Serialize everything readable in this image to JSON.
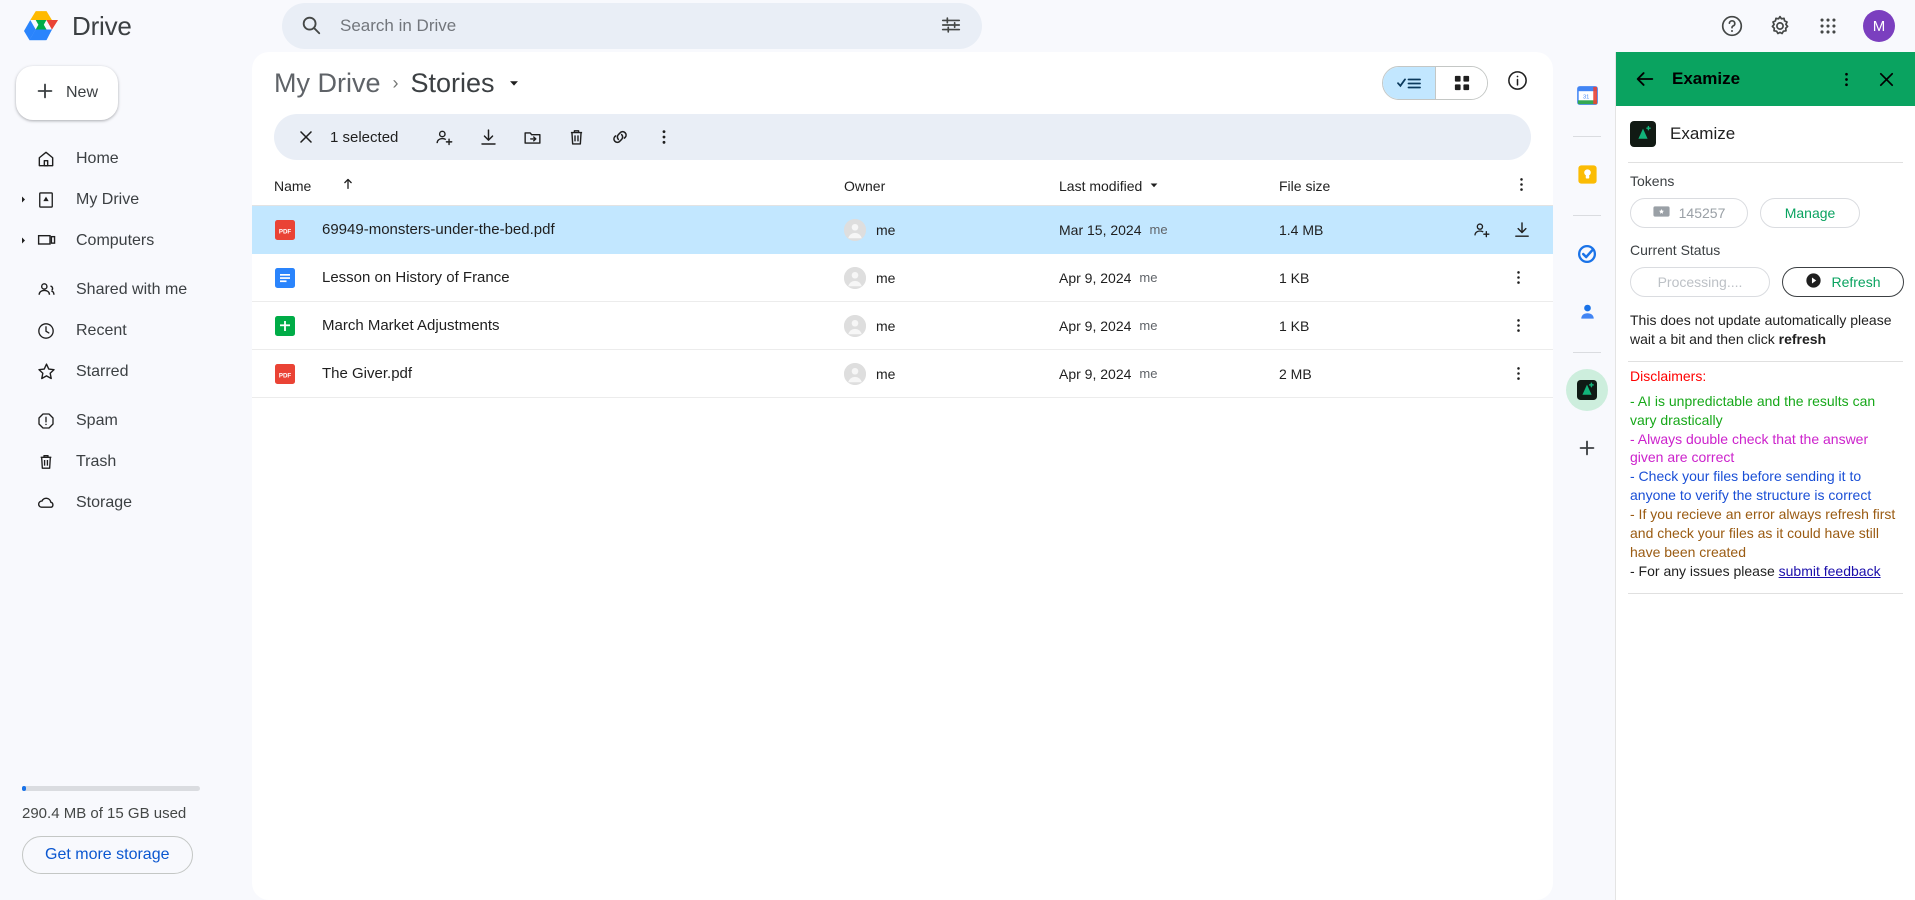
{
  "app": {
    "brand": "Drive",
    "brand_logo_colors": {
      "blue": "#2a84fc",
      "green": "#00ac47",
      "yellow": "#ffba00",
      "red": "#ea4335"
    }
  },
  "search": {
    "placeholder": "Search in Drive",
    "value": "",
    "icon": "search-icon",
    "filter_icon": "tune-icon"
  },
  "topbar": {
    "help_icon": "help-circle-icon",
    "settings_icon": "gear-icon",
    "apps_icon": "apps-grid-icon",
    "avatar_initial": "M",
    "avatar_color": "#7b3fbf"
  },
  "sidebar": {
    "new_label": "New",
    "new_icon": "plus-icon",
    "groups": [
      {
        "items": [
          {
            "label": "Home",
            "icon": "home-icon",
            "expandable": false
          },
          {
            "label": "My Drive",
            "icon": "drive-folder-icon",
            "expandable": true
          },
          {
            "label": "Computers",
            "icon": "computer-icon",
            "expandable": true
          }
        ]
      },
      {
        "items": [
          {
            "label": "Shared with me",
            "icon": "people-icon",
            "expandable": false
          },
          {
            "label": "Recent",
            "icon": "clock-icon",
            "expandable": false
          },
          {
            "label": "Starred",
            "icon": "star-icon",
            "expandable": false
          }
        ]
      },
      {
        "items": [
          {
            "label": "Spam",
            "icon": "spam-icon",
            "expandable": false
          },
          {
            "label": "Trash",
            "icon": "trash-icon",
            "expandable": false
          },
          {
            "label": "Storage",
            "icon": "cloud-icon",
            "expandable": false
          }
        ]
      }
    ],
    "storage": {
      "used_text": "290.4 MB of 15 GB used",
      "percent": 2,
      "button_label": "Get more storage",
      "accent": "#0b57d0"
    }
  },
  "breadcrumb": {
    "root": "My Drive",
    "separator": "›",
    "current": "Stories",
    "caret_icon": "chevron-down-icon"
  },
  "view_toggle": {
    "list_icon": "list-view-icon",
    "grid_icon": "grid-view-icon",
    "active": "list",
    "info_icon": "info-circle-icon"
  },
  "selection_toolbar": {
    "close_icon": "close-icon",
    "count_label": "1 selected",
    "actions": [
      {
        "name": "share-icon"
      },
      {
        "name": "download-icon"
      },
      {
        "name": "move-to-folder-icon"
      },
      {
        "name": "trash-icon"
      },
      {
        "name": "link-icon"
      },
      {
        "name": "more-vertical-icon"
      }
    ]
  },
  "table": {
    "columns": [
      {
        "key": "name",
        "label": "Name",
        "sort_icon": "arrow-up-icon",
        "sorted": true
      },
      {
        "key": "owner",
        "label": "Owner"
      },
      {
        "key": "modified",
        "label": "Last modified",
        "sort_icon": "chevron-down-icon"
      },
      {
        "key": "size",
        "label": "File size"
      }
    ],
    "header_more_icon": "more-vertical-icon",
    "rows": [
      {
        "name": "69949-monsters-under-the-bed.pdf",
        "file_icon": "pdf-icon",
        "file_icon_color": "#ea4335",
        "owner": "me",
        "modified": "Mar 15, 2024",
        "modified_by": "me",
        "size": "1.4 MB",
        "selected": true,
        "actions": [
          {
            "name": "share-icon"
          },
          {
            "name": "download-icon"
          },
          {
            "name": "edit-pencil-icon"
          },
          {
            "name": "star-icon"
          },
          {
            "name": "more-vertical-icon"
          }
        ]
      },
      {
        "name": "Lesson on History of France",
        "file_icon": "google-docs-icon",
        "file_icon_color": "#2a84fc",
        "owner": "me",
        "modified": "Apr 9, 2024",
        "modified_by": "me",
        "size": "1 KB",
        "selected": false,
        "actions": [
          {
            "name": "more-vertical-icon"
          }
        ]
      },
      {
        "name": "March Market Adjustments",
        "file_icon": "google-sheets-icon",
        "file_icon_color": "#00ac47",
        "owner": "me",
        "modified": "Apr 9, 2024",
        "modified_by": "me",
        "size": "1 KB",
        "selected": false,
        "actions": [
          {
            "name": "more-vertical-icon"
          }
        ]
      },
      {
        "name": "The Giver.pdf",
        "file_icon": "pdf-icon",
        "file_icon_color": "#ea4335",
        "owner": "me",
        "modified": "Apr 9, 2024",
        "modified_by": "me",
        "size": "2 MB",
        "selected": false,
        "actions": [
          {
            "name": "more-vertical-icon"
          }
        ]
      }
    ]
  },
  "side_strip": {
    "items": [
      {
        "name": "google-calendar-icon"
      },
      {
        "name": "google-keep-icon"
      },
      {
        "name": "google-tasks-icon"
      },
      {
        "name": "google-contacts-icon"
      },
      {
        "name": "examize-addon-icon",
        "active": true
      }
    ],
    "add_label": "+",
    "add_icon": "plus-icon",
    "active_color": "#cdeedd"
  },
  "panel": {
    "header": {
      "title": "Examize",
      "back_icon": "arrow-left-icon",
      "more_icon": "more-vertical-icon",
      "close_icon": "close-icon",
      "background": "#0aa360"
    },
    "app_name": "Examize",
    "app_logo_icon": "examize-logo-icon",
    "tokens": {
      "label": "Tokens",
      "value": "145257",
      "token_icon": "ticket-icon",
      "manage_label": "Manage"
    },
    "status": {
      "label": "Current Status",
      "value": "Processing....",
      "refresh_label": "Refresh",
      "refresh_icon": "play-circle-icon"
    },
    "note_prefix": "This does not update automatically please wait a bit and then click ",
    "note_bold": "refresh",
    "disclaimers": {
      "title": "Disclaimers:",
      "title_color": "#ff0000",
      "lines": [
        {
          "text": "- AI is unpredictable and the results can vary drastically",
          "color": "#17a81a"
        },
        {
          "text": "- Always double check that the answer given are correct",
          "color": "#cc22cc"
        },
        {
          "text": "- Check your files before sending it to anyone to verify the structure is correct",
          "color": "#1a4fd6"
        },
        {
          "text": "- If you recieve an error always refresh first and check your files as it could have still have been created",
          "color": "#9a5b12"
        }
      ],
      "feedback_prefix": "- For any issues please ",
      "feedback_link": "submit feedback",
      "feedback_color": "#1f1f1f"
    }
  }
}
